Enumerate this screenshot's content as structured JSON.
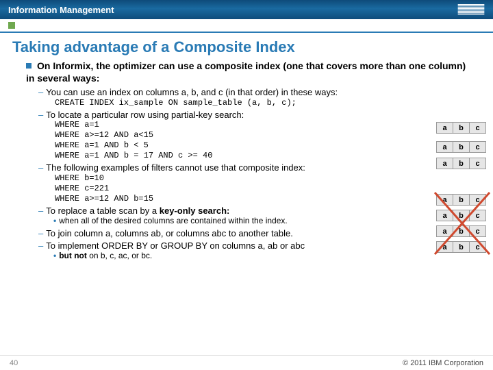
{
  "header": {
    "brand": "Information Management",
    "logo_alt": "IBM"
  },
  "topic": {
    "parent": "",
    "current": ""
  },
  "slide": {
    "title": "Taking advantage of a Composite Index",
    "bullet_main": "On Informix, the optimizer can use a composite index (one that covers more than one column) in several ways:",
    "sub1": "You can use an index on columns a, b, and c (in that order) in these ways:",
    "code1": "CREATE INDEX ix_sample ON sample_table (a, b, c);",
    "sub2": "To locate a particular row using partial-key search:",
    "code2": "WHERE a=1\nWHERE a>=12 AND a<15\nWHERE a=1 AND b < 5\nWHERE a=1 AND b = 17 AND c >= 40",
    "sub3": "The following examples of filters cannot use that composite index:",
    "code3": "WHERE b=10\nWHERE c=221\nWHERE a>=12 AND b=15",
    "sub4_pre": "To replace a table scan by a ",
    "sub4_strong": "key-only search:",
    "sub4_bullet": "when all of the desired columns are contained within the index.",
    "sub5": "To join column a, columns ab, or columns abc to another table.",
    "sub6": "To implement ORDER BY or GROUP BY on columns a, ab or abc",
    "sub6_bullet_pre": "but not",
    "sub6_bullet_post": " on b, c, ac, or bc."
  },
  "tables": {
    "cols": [
      "a",
      "b",
      "c"
    ]
  },
  "footer": {
    "page": "40",
    "copyright": "© 2011 IBM Corporation"
  }
}
